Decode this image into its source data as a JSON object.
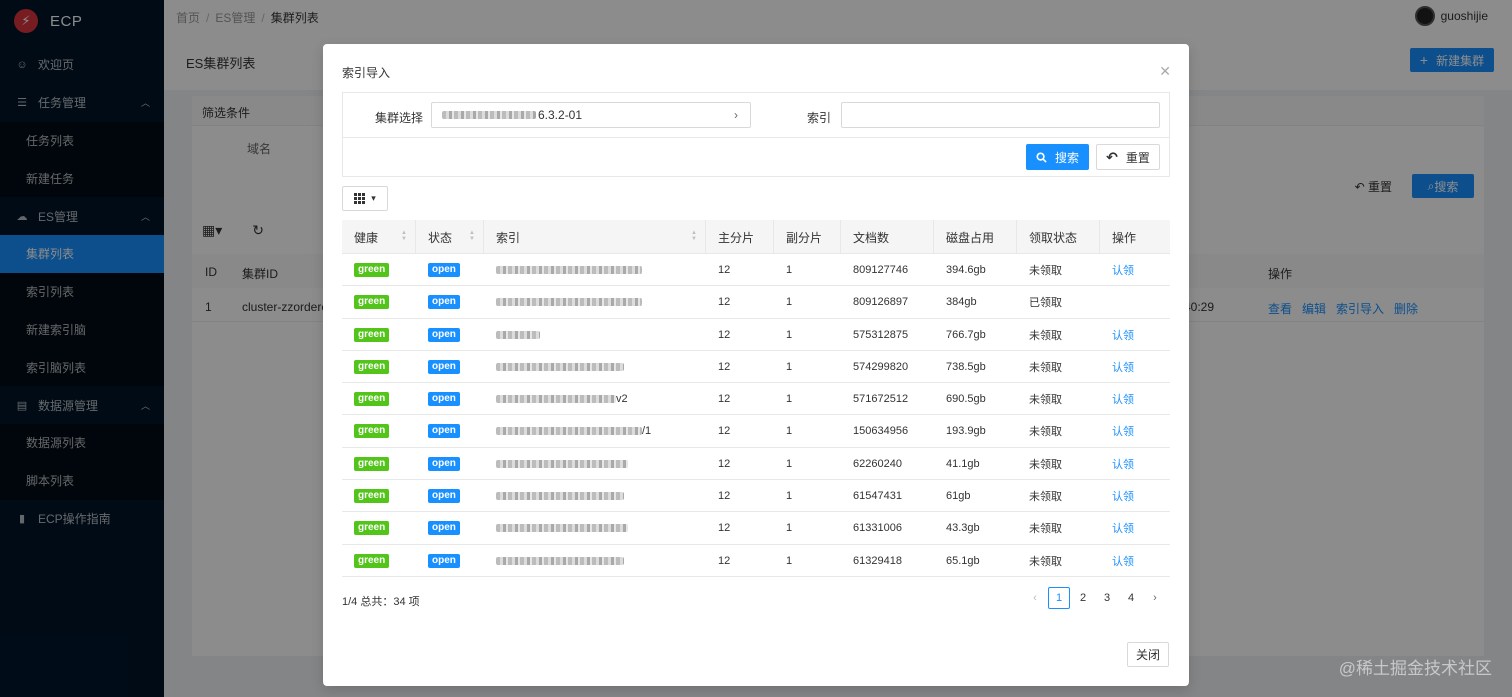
{
  "app": {
    "name": "ECP"
  },
  "sidebar": {
    "items": [
      {
        "label": "欢迎页",
        "icon": "smile-icon",
        "type": "item"
      },
      {
        "label": "任务管理",
        "icon": "list-icon",
        "type": "group"
      },
      {
        "label": "任务列表",
        "type": "sub"
      },
      {
        "label": "新建任务",
        "type": "sub"
      },
      {
        "label": "ES管理",
        "icon": "cloud-icon",
        "type": "group"
      },
      {
        "label": "集群列表",
        "type": "sub",
        "active": true
      },
      {
        "label": "索引列表",
        "type": "sub"
      },
      {
        "label": "新建索引脑",
        "type": "sub"
      },
      {
        "label": "索引脑列表",
        "type": "sub"
      },
      {
        "label": "数据源管理",
        "icon": "database-icon",
        "type": "group"
      },
      {
        "label": "数据源列表",
        "type": "sub"
      },
      {
        "label": "脚本列表",
        "type": "sub"
      },
      {
        "label": "ECP操作指南",
        "icon": "book-icon",
        "type": "item"
      }
    ]
  },
  "header": {
    "breadcrumb": [
      "首页",
      "ES管理",
      "集群列表"
    ],
    "user": "guoshijie"
  },
  "page": {
    "title": "ES集群列表",
    "new_button": "新建集群",
    "filter_title": "筛选条件",
    "domain_label": "域名",
    "reset_label": "重置",
    "search_label": "搜索",
    "table_headers": [
      "ID",
      "集群ID",
      "操作"
    ],
    "row": {
      "id": "1",
      "cluster_id": "cluster-zzorderes",
      "time_fragment": "40:29",
      "actions": [
        "查看",
        "编辑",
        "索引导入",
        "删除"
      ]
    }
  },
  "modal": {
    "title": "索引导入",
    "cluster_label": "集群选择",
    "cluster_value": "6.3.2-01",
    "index_label": "索引",
    "index_value": "",
    "search_button": "搜索",
    "reset_button": "重置",
    "columns": [
      "健康",
      "状态",
      "索引",
      "主分片",
      "副分片",
      "文档数",
      "磁盘占用",
      "领取状态",
      "操作"
    ],
    "rows": [
      {
        "health": "green",
        "status": "open",
        "index_suffix": "",
        "primary": "12",
        "replica": "1",
        "docs": "809127746",
        "disk": "394.6gb",
        "claim_status": "未领取",
        "action": "认领"
      },
      {
        "health": "green",
        "status": "open",
        "index_suffix": "",
        "primary": "12",
        "replica": "1",
        "docs": "809126897",
        "disk": "384gb",
        "claim_status": "已领取",
        "action": ""
      },
      {
        "health": "green",
        "status": "open",
        "index_suffix": "",
        "primary": "12",
        "replica": "1",
        "docs": "575312875",
        "disk": "766.7gb",
        "claim_status": "未领取",
        "action": "认领"
      },
      {
        "health": "green",
        "status": "open",
        "index_suffix": "",
        "primary": "12",
        "replica": "1",
        "docs": "574299820",
        "disk": "738.5gb",
        "claim_status": "未领取",
        "action": "认领"
      },
      {
        "health": "green",
        "status": "open",
        "index_suffix": "v2",
        "primary": "12",
        "replica": "1",
        "docs": "571672512",
        "disk": "690.5gb",
        "claim_status": "未领取",
        "action": "认领"
      },
      {
        "health": "green",
        "status": "open",
        "index_suffix": "/1",
        "primary": "12",
        "replica": "1",
        "docs": "150634956",
        "disk": "193.9gb",
        "claim_status": "未领取",
        "action": "认领"
      },
      {
        "health": "green",
        "status": "open",
        "index_suffix": "",
        "primary": "12",
        "replica": "1",
        "docs": "62260240",
        "disk": "41.1gb",
        "claim_status": "未领取",
        "action": "认领"
      },
      {
        "health": "green",
        "status": "open",
        "index_suffix": "",
        "primary": "12",
        "replica": "1",
        "docs": "61547431",
        "disk": "61gb",
        "claim_status": "未领取",
        "action": "认领"
      },
      {
        "health": "green",
        "status": "open",
        "index_suffix": "",
        "primary": "12",
        "replica": "1",
        "docs": "61331006",
        "disk": "43.3gb",
        "claim_status": "未领取",
        "action": "认领"
      },
      {
        "health": "green",
        "status": "open",
        "index_suffix": "",
        "primary": "12",
        "replica": "1",
        "docs": "61329418",
        "disk": "65.1gb",
        "claim_status": "未领取",
        "action": "认领"
      }
    ],
    "pager_info": "1/4 总共：34 项",
    "pages": [
      "1",
      "2",
      "3",
      "4"
    ],
    "current_page": "1",
    "close_button": "关闭"
  },
  "watermark": "@稀土掘金技术社区",
  "colors": {
    "primary": "#1890ff",
    "success": "#52c41a",
    "sidebar": "#001529",
    "logo": "#d9363e"
  }
}
